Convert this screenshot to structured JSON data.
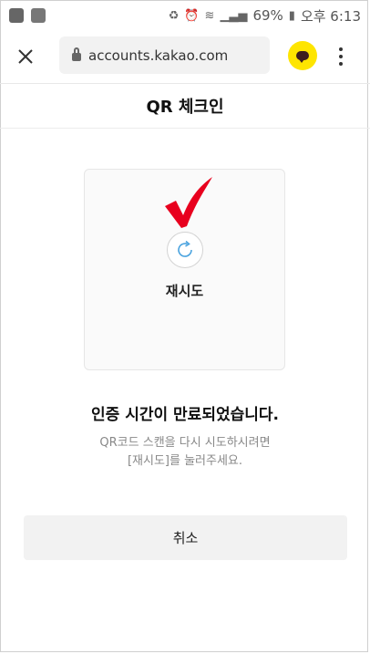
{
  "status_bar": {
    "battery": "69%",
    "time_label": "오후 6:13"
  },
  "browser": {
    "url": "accounts.kakao.com",
    "icons": [
      "close-icon",
      "lock-icon",
      "kakao-talk-icon",
      "more-vert-icon"
    ]
  },
  "page": {
    "title": "QR 체크인",
    "retry_label": "재시도",
    "expired_title": "인증 시간이 만료되었습니다.",
    "expired_desc_line1": "QR코드 스캔을 다시 시도하시려면",
    "expired_desc_line2": "[재시도]를 눌러주세요.",
    "cancel_label": "취소"
  },
  "colors": {
    "accent_check": "#e8001e",
    "kakao_yellow": "#fee500",
    "refresh_blue": "#4aa3df"
  }
}
